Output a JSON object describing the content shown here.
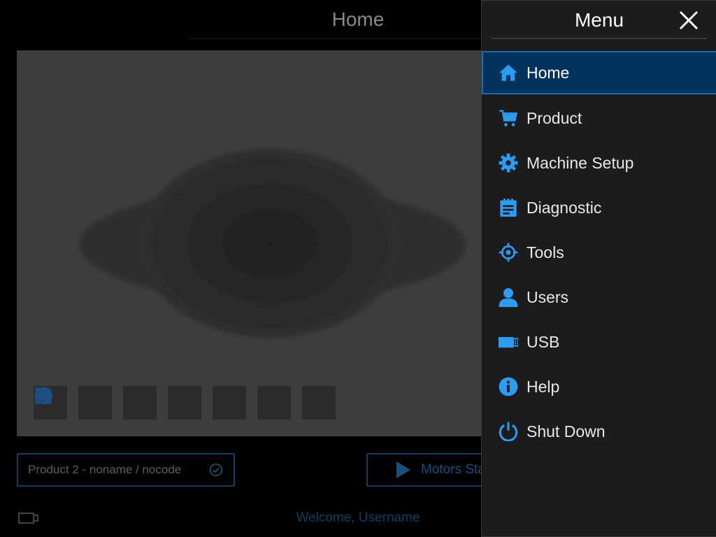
{
  "header": {
    "title": "Home"
  },
  "toolbar": {
    "tools": [
      "expand-icon",
      "zoom-in-icon",
      "brightness-icon",
      "contrast-icon",
      "usb-drive-icon",
      "save-icon",
      "chevron-left-icon"
    ]
  },
  "product": {
    "label": "Product 2 - noname / nocode"
  },
  "motors": {
    "label": "Motors Start"
  },
  "status": {
    "welcome": "Welcome, Username"
  },
  "menu": {
    "title": "Menu",
    "active": "Home",
    "items": [
      {
        "label": "Home",
        "icon": "home-icon"
      },
      {
        "label": "Product",
        "icon": "cart-icon"
      },
      {
        "label": "Machine Setup",
        "icon": "gear-icon"
      },
      {
        "label": "Diagnostic",
        "icon": "clipboard-icon"
      },
      {
        "label": "Tools",
        "icon": "crosshair-icon"
      },
      {
        "label": "Users",
        "icon": "user-icon"
      },
      {
        "label": "USB",
        "icon": "usb-icon"
      },
      {
        "label": "Help",
        "icon": "info-icon"
      },
      {
        "label": "Shut Down",
        "icon": "power-icon"
      }
    ]
  },
  "colors": {
    "accent": "#2d9bf0",
    "active_item_bg": "#02335c",
    "menu_bg": "#1c1c1e"
  }
}
